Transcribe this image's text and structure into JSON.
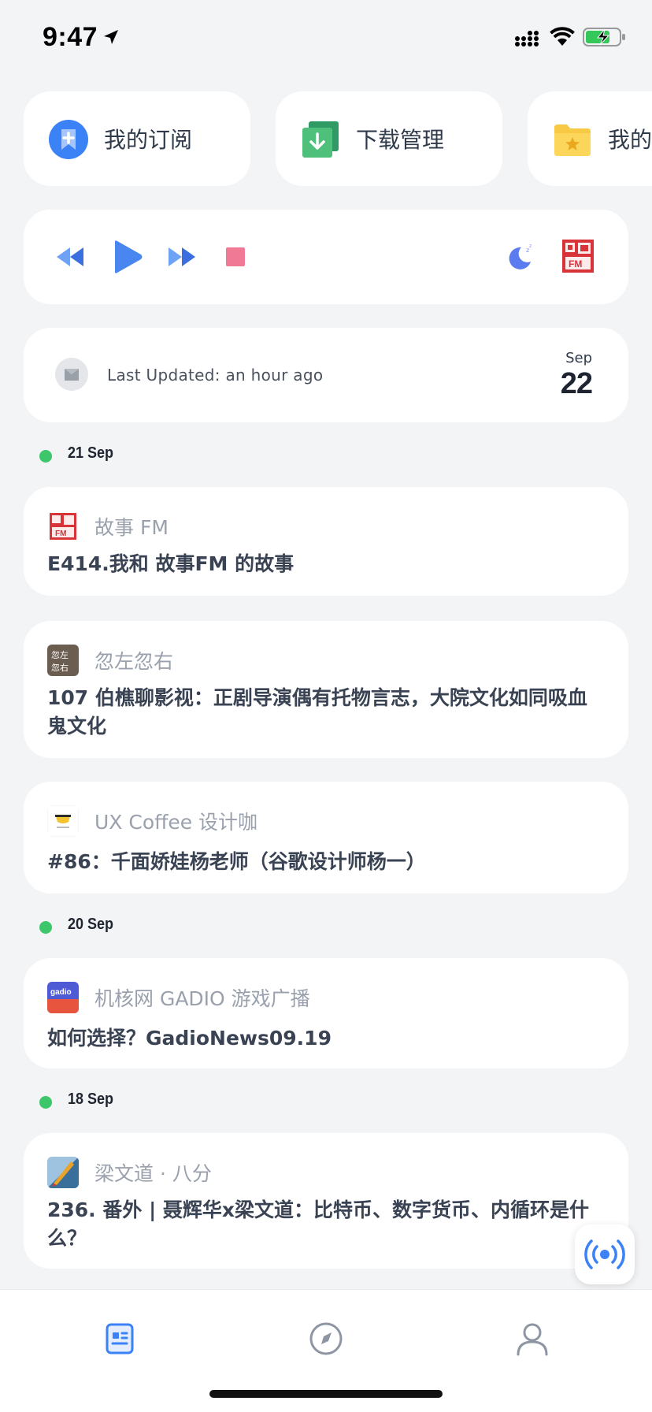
{
  "status_bar": {
    "time": "9:47"
  },
  "quick_links": [
    {
      "label": "我的订阅",
      "icon": "subscribe-icon"
    },
    {
      "label": "下载管理",
      "icon": "download-icon"
    },
    {
      "label": "我的收",
      "icon": "folder-star-icon"
    }
  ],
  "player": {
    "controls": [
      "rewind-icon",
      "play-icon",
      "fast-forward-icon",
      "stop-icon",
      "sleep-timer-icon"
    ],
    "now_playing_logo": "gushi-fm-logo"
  },
  "update": {
    "text": "Last Updated: an hour ago",
    "month": "Sep",
    "day": "22"
  },
  "sections": [
    {
      "title": "21 Sep",
      "episodes": [
        {
          "podcast": "故事 FM",
          "title": "E414.我和 故事FM 的故事"
        },
        {
          "podcast": "忽左忽右",
          "title": "107 伯樵聊影视：正剧导演偶有托物言志，大院文化如同吸血鬼文化"
        },
        {
          "podcast": "UX Coffee 设计咖",
          "title": "#86：千面娇娃杨老师（谷歌设计师杨一）"
        }
      ]
    },
    {
      "title": "20 Sep",
      "episodes": [
        {
          "podcast": "机核网 GADIO 游戏广播",
          "title": "如何选择？GadioNews09.19"
        }
      ]
    },
    {
      "title": "18 Sep",
      "episodes": [
        {
          "podcast": "梁文道 · 八分",
          "title": "236. 番外 | 聂辉华x梁文道：比特币、数字货币、内循环是什么？"
        }
      ]
    }
  ],
  "logo_text": {
    "gushi_fm": "故事FM",
    "huzuo": "忽左忽右",
    "gadio": "gadio"
  },
  "colors": {
    "accent": "#3b82f6",
    "section_dot": "#3ec66b",
    "background": "#f3f4f6"
  },
  "tabs": [
    {
      "name": "tab-feed",
      "icon": "feed-icon",
      "active": true
    },
    {
      "name": "tab-discover",
      "icon": "compass-icon",
      "active": false
    },
    {
      "name": "tab-profile",
      "icon": "profile-icon",
      "active": false
    }
  ]
}
